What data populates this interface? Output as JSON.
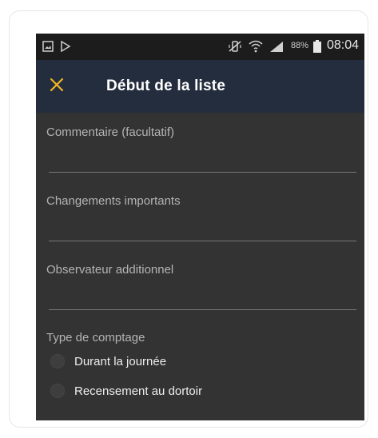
{
  "status_bar": {
    "battery_percent": "88%",
    "time": "08:04"
  },
  "app_bar": {
    "title": "Début de la liste",
    "close_icon": "close-icon",
    "accent_color": "#f1b623"
  },
  "form": {
    "comment": {
      "label": "Commentaire (facultatif)",
      "value": ""
    },
    "important_changes": {
      "label": "Changements importants",
      "value": ""
    },
    "additional_observer": {
      "label": "Observateur additionnel",
      "value": ""
    },
    "count_type": {
      "label": "Type de comptage",
      "options": [
        "Durant la journée",
        "Recensement au dortoir"
      ],
      "selected": null
    }
  }
}
